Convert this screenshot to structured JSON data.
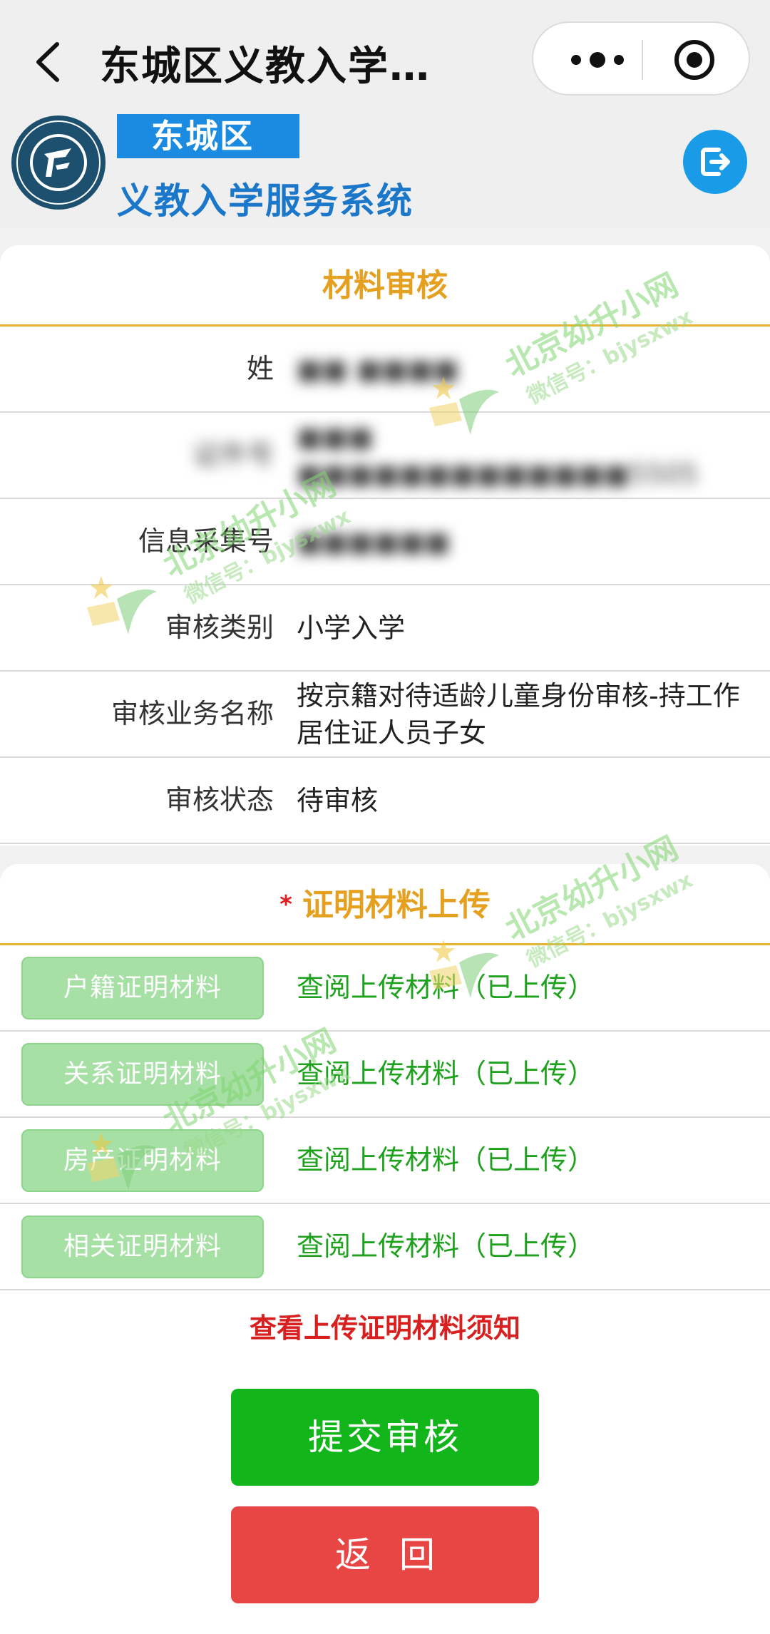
{
  "nav": {
    "title": "东城区义教入学…"
  },
  "header": {
    "district": "东城区",
    "system_name": "义教入学服务系统"
  },
  "review_section": {
    "title": "材料审核",
    "rows": [
      {
        "label": "姓",
        "value": "■■ ■■■■",
        "blurred": true
      },
      {
        "label": "证件号",
        "value": "■■■ ■■■■■■■■■■■■■5505",
        "blurred": true
      },
      {
        "label": "信息采集号",
        "value": "■■■■■■",
        "blurred": true
      },
      {
        "label": "审核类别",
        "value": "小学入学",
        "blurred": false
      },
      {
        "label": "审核业务名称",
        "value": "按京籍对待适龄儿童身份审核-持工作居住证人员子女",
        "blurred": false
      },
      {
        "label": "审核状态",
        "value": "待审核",
        "blurred": false
      }
    ]
  },
  "upload_section": {
    "required_mark": "*",
    "title": "证明材料上传",
    "rows": [
      {
        "button": "户籍证明材料",
        "link": "查阅上传材料（已上传）"
      },
      {
        "button": "关系证明材料",
        "link": "查阅上传材料（已上传）"
      },
      {
        "button": "房产证明材料",
        "link": "查阅上传材料（已上传）"
      },
      {
        "button": "相关证明材料",
        "link": "查阅上传材料（已上传）"
      }
    ],
    "notice_link": "查看上传证明材料须知",
    "submit_button": "提交审核",
    "back_button": "返回"
  },
  "watermark": {
    "line1": "北京幼升小网",
    "line2": "微信号：bjysxwx"
  },
  "colors": {
    "accent_blue": "#1a8be0",
    "title_orange": "#e6a020",
    "link_green": "#1ea21e",
    "submit_green": "#12b51a",
    "back_red": "#e84545",
    "notice_red": "#d82020"
  },
  "icons": {
    "back": "chevron-left-icon",
    "more": "more-dots-icon",
    "close": "target-circle-icon",
    "logout": "logout-icon",
    "logo": "education-logo-icon"
  }
}
